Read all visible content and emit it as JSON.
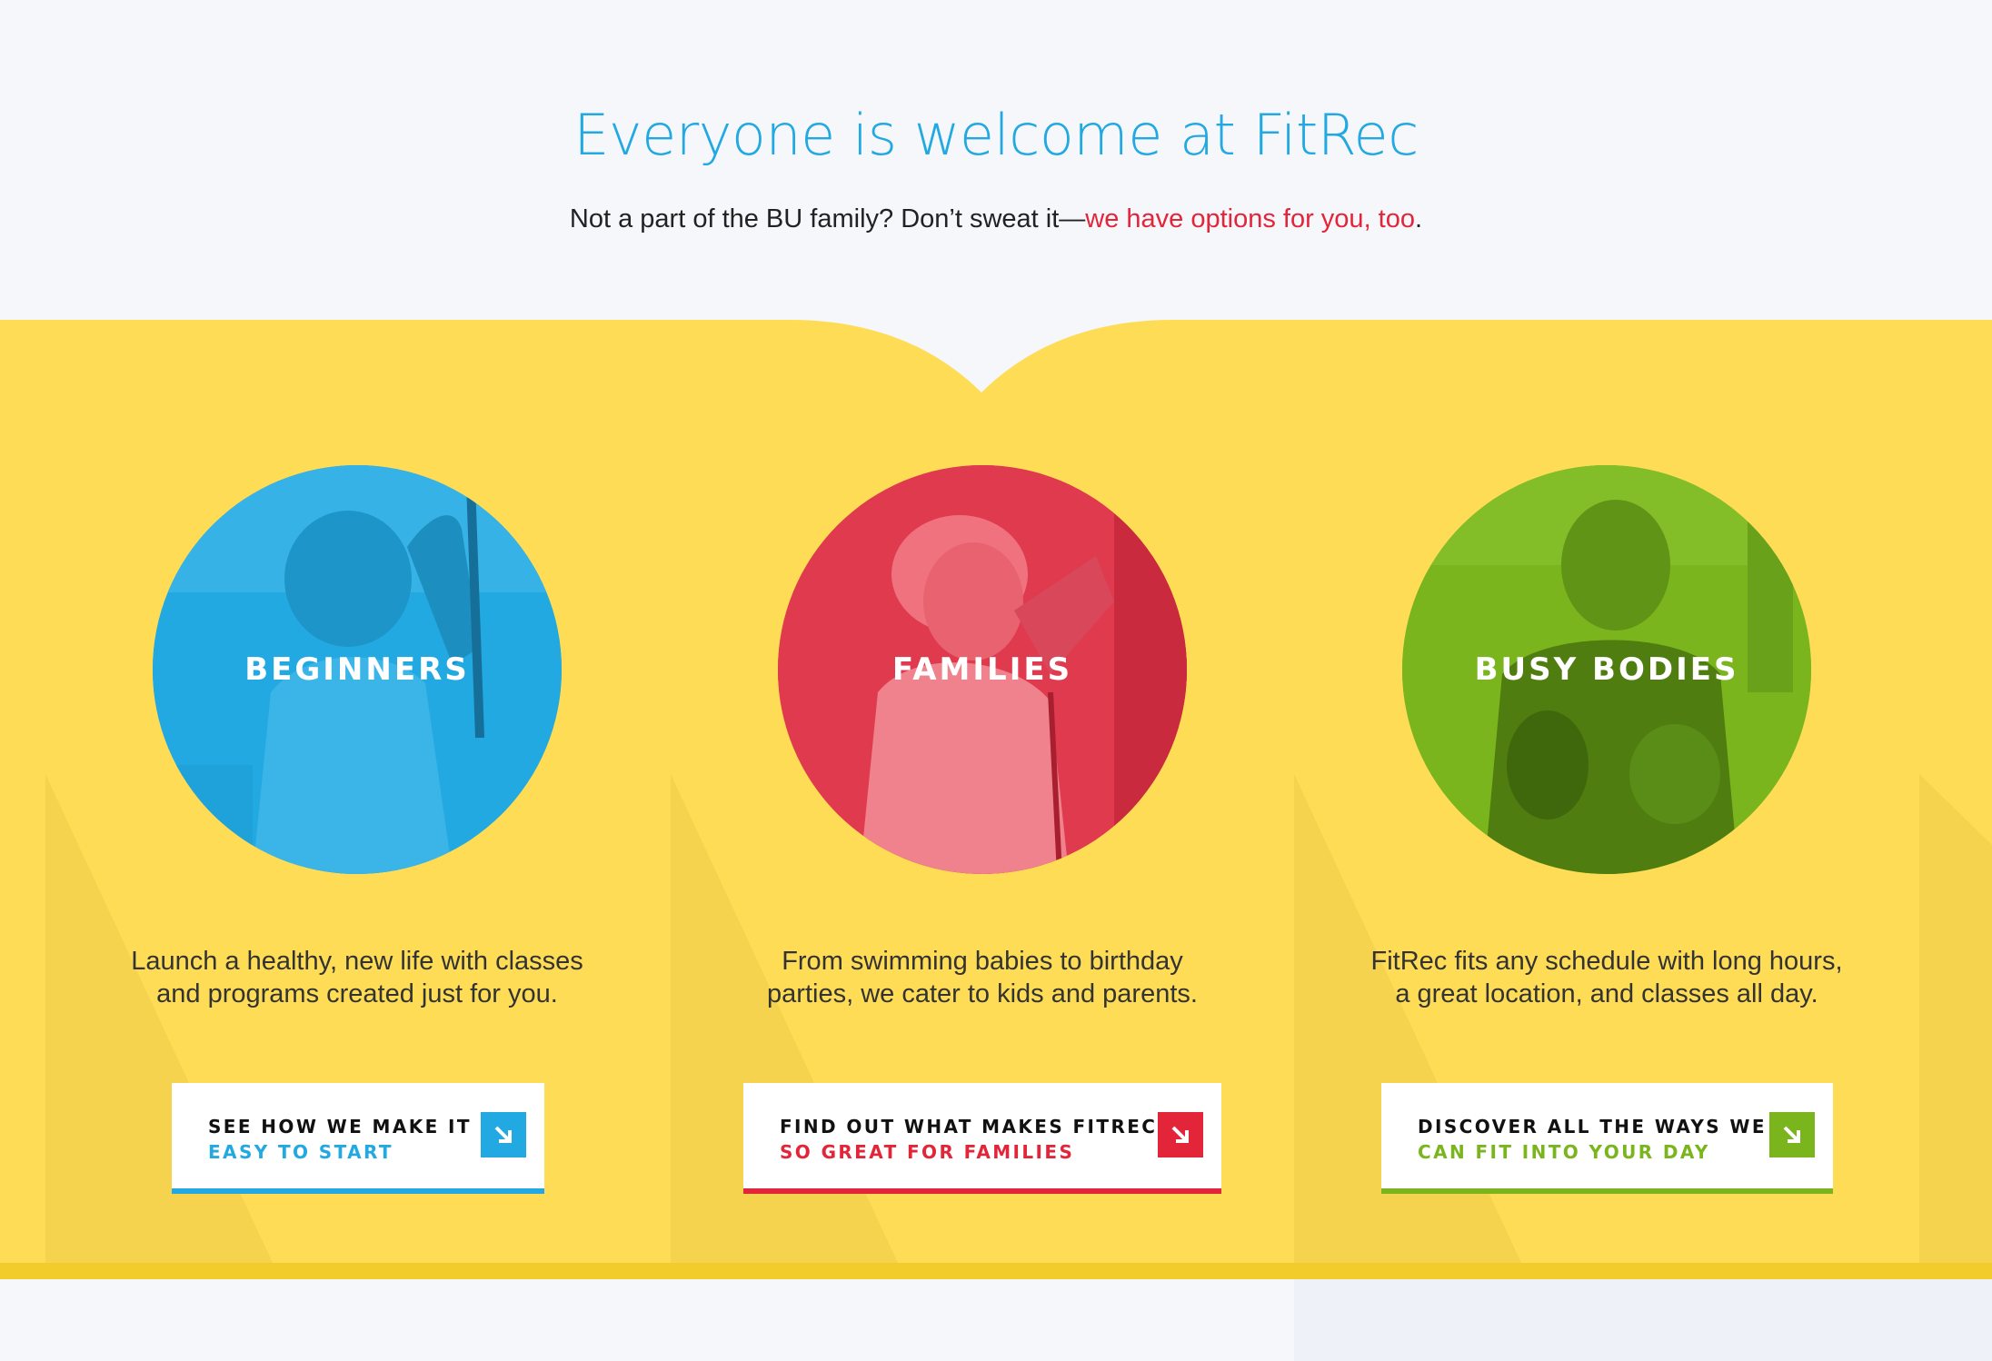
{
  "hero": {
    "title": "Everyone is welcome at FitRec",
    "subtitle_lead": "Not a part of the BU family? Don’t sweat it—",
    "subtitle_link": "we have options for you, too",
    "subtitle_end": "."
  },
  "colors": {
    "blue": "#22a9e2",
    "red": "#e3253a",
    "green": "#7ab51d",
    "yellow": "#fedc55"
  },
  "cards": [
    {
      "title": "BEGINNERS",
      "desc_line1": "Launch a healthy, new life with classes",
      "desc_line2": "and programs created just for you.",
      "cta_line1": "SEE HOW WE MAKE IT",
      "cta_line2": "EASY TO START",
      "arrow_icon": "arrow-down-right-icon"
    },
    {
      "title": "FAMILIES",
      "desc_line1": "From swimming babies to birthday",
      "desc_line2": "parties, we cater to kids and parents.",
      "cta_line1": "FIND OUT WHAT MAKES FITREC",
      "cta_line2": "SO GREAT FOR FAMILIES",
      "arrow_icon": "arrow-down-right-icon"
    },
    {
      "title": "BUSY BODIES",
      "desc_line1": "FitRec fits any schedule with long hours,",
      "desc_line2": "a great location, and classes all day.",
      "cta_line1": "DISCOVER ALL THE WAYS WE",
      "cta_line2": "CAN FIT INTO YOUR DAY",
      "arrow_icon": "arrow-down-right-icon"
    }
  ]
}
